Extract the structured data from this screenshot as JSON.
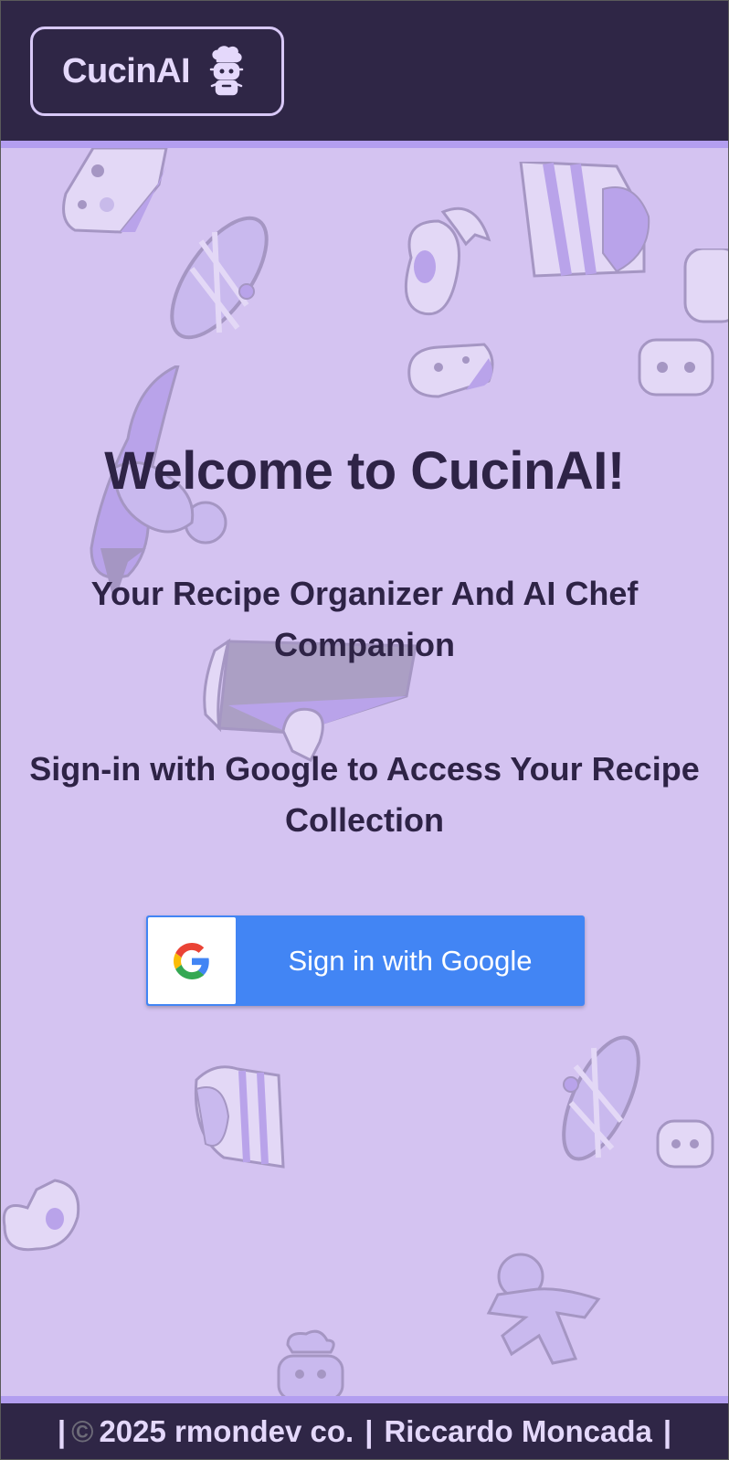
{
  "header": {
    "brand_name": "CucinAI",
    "brand_icon": "chef-robot-icon"
  },
  "main": {
    "title": "Welcome to CucinAI!",
    "subtitle": "Your Recipe Organizer And AI Chef Companion",
    "signin_prompt": "Sign-in with Google to Access Your Recipe Collection",
    "signin_button": {
      "label": "Sign in with Google",
      "icon": "google-g-icon"
    }
  },
  "footer": {
    "left_sep": "|",
    "copyright_symbol": "©",
    "text": "2025 rmondev co.",
    "mid_sep": "|",
    "author": "Riccardo Moncada",
    "right_sep": "|"
  },
  "colors": {
    "header_bg": "#2f2646",
    "page_bg": "#d4c3f1",
    "accent_border": "#b39ef0",
    "google_blue": "#4285f4",
    "text_dark": "#2e2346"
  }
}
